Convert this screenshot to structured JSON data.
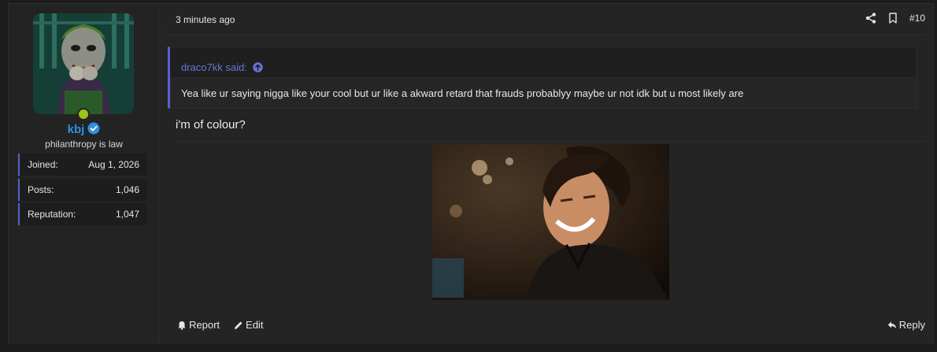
{
  "user": {
    "username": "kbj",
    "title": "philanthropy is law",
    "stats": [
      {
        "label": "Joined:",
        "value": "Aug 1, 2026"
      },
      {
        "label": "Posts:",
        "value": "1,046"
      },
      {
        "label": "Reputation:",
        "value": "1,047"
      }
    ],
    "online_color": "#9cc21b",
    "name_color": "#2f8fe0"
  },
  "post": {
    "time": "3 minutes ago",
    "number": "#10",
    "quote": {
      "author": "draco7kk said:",
      "text": "Yea like ur saying nigga like your cool but ur like a akward retard that frauds probablyy maybe ur not idk but u most likely are"
    },
    "body": "i'm of colour?",
    "actions": {
      "report": "Report",
      "edit": "Edit",
      "reply": "Reply"
    }
  },
  "icons": {
    "share": "share-icon",
    "bookmark": "bookmark-icon",
    "quote_up": "arrow-up-circle-icon",
    "verified": "verified-badge-icon",
    "report": "bell-icon",
    "edit": "pencil-icon",
    "reply": "reply-icon"
  },
  "colors": {
    "accent": "#5b5fd1",
    "background": "#1c1c1c",
    "panel": "#242424"
  }
}
